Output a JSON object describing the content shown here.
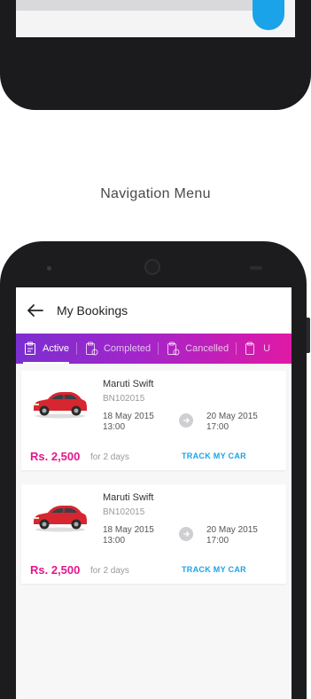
{
  "caption": "Navigation Menu",
  "appbar": {
    "title": "My Bookings"
  },
  "tabs": [
    {
      "label": "Active"
    },
    {
      "label": "Completed"
    },
    {
      "label": "Cancelled"
    },
    {
      "label": "U"
    }
  ],
  "bookings": [
    {
      "car": "Maruti Swift",
      "id": "BN102015",
      "start_date": "18 May 2015",
      "start_time": "13:00",
      "end_date": "20 May 2015",
      "end_time": "17:00",
      "price": "Rs. 2,500",
      "duration": "for 2 days",
      "action": "TRACK MY CAR"
    },
    {
      "car": "Maruti Swift",
      "id": "BN102015",
      "start_date": "18 May 2015",
      "start_time": "13:00",
      "end_date": "20 May 2015",
      "end_time": "17:00",
      "price": "Rs. 2,500",
      "duration": "for 2 days",
      "action": "TRACK MY CAR"
    }
  ],
  "colors": {
    "accent": "#e6158d",
    "link": "#1aa3e8",
    "tab_start": "#7b2fd0",
    "tab_end": "#e019a6"
  }
}
